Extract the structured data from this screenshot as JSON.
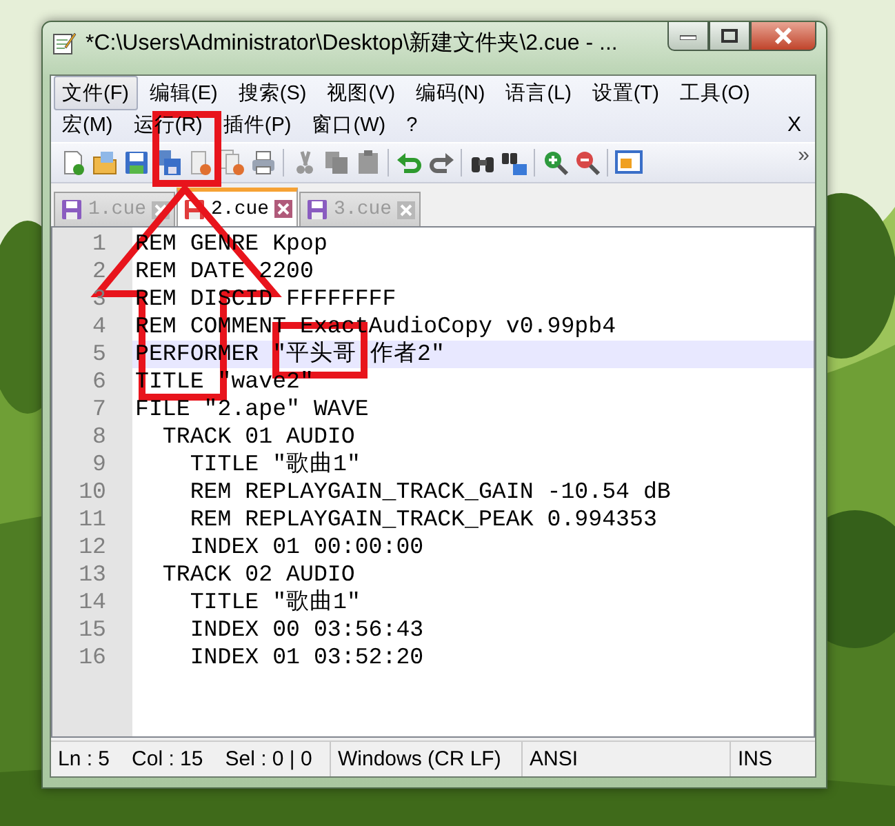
{
  "window": {
    "title": "*C:\\Users\\Administrator\\Desktop\\新建文件夹\\2.cue - ..."
  },
  "menu_rows": [
    [
      {
        "label": "文件(F)",
        "selected": true
      },
      {
        "label": "编辑(E)",
        "selected": false
      },
      {
        "label": "搜索(S)",
        "selected": false
      },
      {
        "label": "视图(V)",
        "selected": false
      },
      {
        "label": "编码(N)",
        "selected": false
      },
      {
        "label": "语言(L)",
        "selected": false
      },
      {
        "label": "设置(T)",
        "selected": false
      },
      {
        "label": "工具(O)",
        "selected": false
      }
    ],
    [
      {
        "label": "宏(M)",
        "selected": false
      },
      {
        "label": "运行(R)",
        "selected": false
      },
      {
        "label": "插件(P)",
        "selected": false
      },
      {
        "label": "窗口(W)",
        "selected": false
      },
      {
        "label": "?",
        "selected": false
      }
    ]
  ],
  "menu_close": "X",
  "toolbar": {
    "overflow": "»"
  },
  "tabs": [
    {
      "label": "1.cue",
      "selected": false,
      "modified": false
    },
    {
      "label": "2.cue",
      "selected": true,
      "modified": true
    },
    {
      "label": "3.cue",
      "selected": false,
      "modified": false
    }
  ],
  "editor": {
    "lines": [
      {
        "number": "1",
        "text": "REM GENRE Kpop",
        "current": false
      },
      {
        "number": "2",
        "text": "REM DATE 2200",
        "current": false
      },
      {
        "number": "3",
        "text": "REM DISCID FFFFFFFF",
        "current": false
      },
      {
        "number": "4",
        "text": "REM COMMENT ExactAudioCopy v0.99pb4",
        "current": false
      },
      {
        "number": "5",
        "text": "PERFORMER \"平头哥 作者2\"",
        "current": true
      },
      {
        "number": "6",
        "text": "TITLE \"wave2\"",
        "current": false
      },
      {
        "number": "7",
        "text": "FILE \"2.ape\" WAVE",
        "current": false
      },
      {
        "number": "8",
        "text": "  TRACK 01 AUDIO",
        "current": false
      },
      {
        "number": "9",
        "text": "    TITLE \"歌曲1\"",
        "current": false
      },
      {
        "number": "10",
        "text": "    REM REPLAYGAIN_TRACK_GAIN -10.54 dB",
        "current": false
      },
      {
        "number": "11",
        "text": "    REM REPLAYGAIN_TRACK_PEAK 0.994353",
        "current": false
      },
      {
        "number": "12",
        "text": "    INDEX 01 00:00:00",
        "current": false
      },
      {
        "number": "13",
        "text": "  TRACK 02 AUDIO",
        "current": false
      },
      {
        "number": "14",
        "text": "    TITLE \"歌曲1\"",
        "current": false
      },
      {
        "number": "15",
        "text": "    INDEX 00 03:56:43",
        "current": false
      },
      {
        "number": "16",
        "text": "    INDEX 01 03:52:20",
        "current": false
      }
    ]
  },
  "status_bar": {
    "ln": "Ln : 5",
    "col": "Col : 15",
    "sel": "Sel : 0 | 0",
    "eol": "Windows (CR LF)",
    "encoding": "ANSI",
    "mode": "INS"
  },
  "annotations": [
    {
      "kind": "box"
    },
    {
      "kind": "box"
    },
    {
      "kind": "arrow"
    }
  ]
}
